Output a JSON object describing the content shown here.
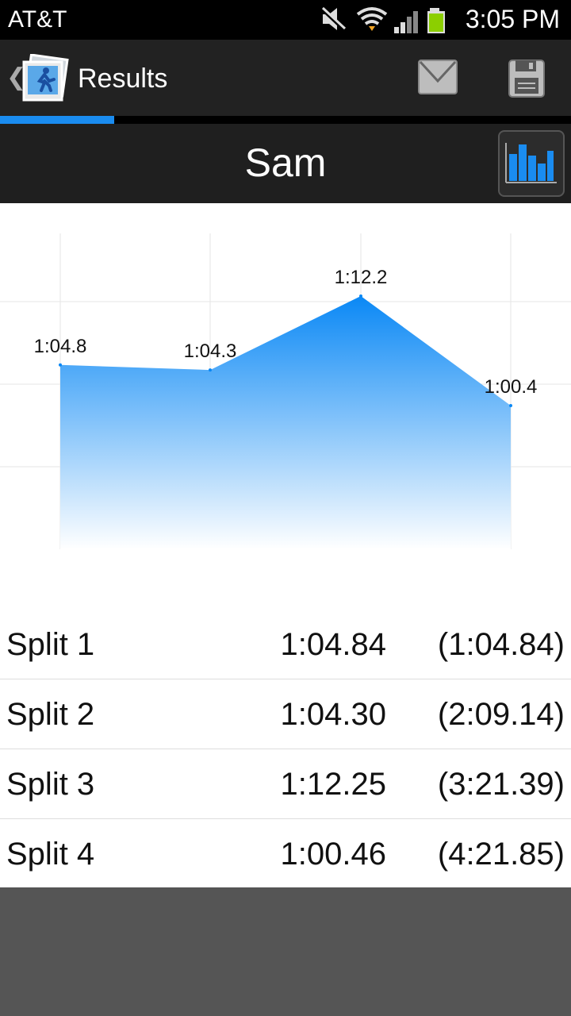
{
  "status_bar": {
    "carrier": "AT&T",
    "time": "3:05 PM",
    "icons": [
      "mute-icon",
      "wifi-icon",
      "signal-icon",
      "battery-icon"
    ]
  },
  "action_bar": {
    "title": "Results",
    "icons": [
      "up-chevron-icon",
      "runner-app-icon",
      "mail-icon",
      "save-icon"
    ]
  },
  "runner": {
    "name": "Sam"
  },
  "colors": {
    "accent": "#1a8cf0",
    "chart_fill_top": "#0a88f5",
    "chart_fill_bottom": "#ffffff"
  },
  "chart_data": {
    "type": "area",
    "categories": [
      "Split 1",
      "Split 2",
      "Split 3",
      "Split 4"
    ],
    "values": [
      64.84,
      64.3,
      72.25,
      60.46
    ],
    "data_labels": [
      "1:04.8",
      "1:04.3",
      "1:12.2",
      "1:00.4"
    ],
    "ylim": [
      45,
      79
    ],
    "grid": true
  },
  "splits": [
    {
      "label": "Split 1",
      "time": "1:04.84",
      "cumulative": "(1:04.84)"
    },
    {
      "label": "Split 2",
      "time": "1:04.30",
      "cumulative": "(2:09.14)"
    },
    {
      "label": "Split 3",
      "time": "1:12.25",
      "cumulative": "(3:21.39)"
    },
    {
      "label": "Split 4",
      "time": "1:00.46",
      "cumulative": "(4:21.85)"
    }
  ]
}
